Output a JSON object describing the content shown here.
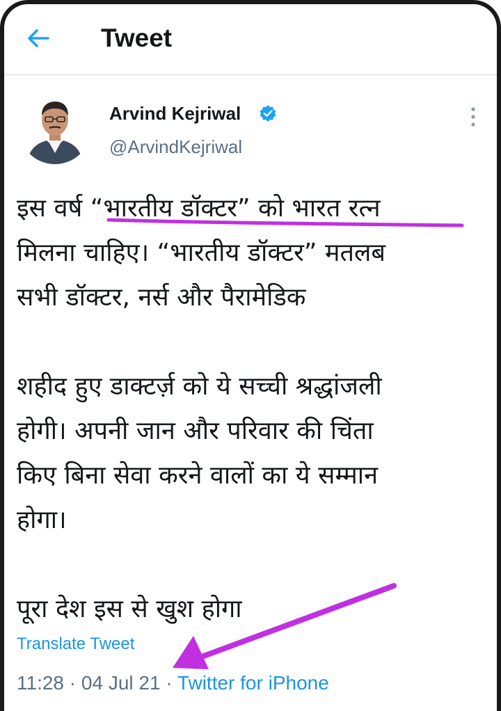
{
  "header": {
    "title": "Tweet",
    "back_icon": "arrow-left-icon"
  },
  "author": {
    "name": "Arvind Kejriwal",
    "handle": "@ArvindKejriwal",
    "verified": true
  },
  "tweet": {
    "paragraph_1": "इस वर्ष “भारतीय डॉक्टर” को भारत रत्न\nमिलना चाहिए। “भारतीय डॉक्टर” मतलब\nसभी डॉक्टर, नर्स और पैरामेडिक",
    "paragraph_2": "शहीद हुए डाक्टर्ज़ को ये सच्ची श्रद्धांजली\nहोगी। अपनी जान और परिवार की चिंता\nकिए बिना सेवा करने वालों का ये सम्मान\nहोगा।",
    "paragraph_3": "पूरा देश इस से खुश होगा",
    "translate_label": "Translate Tweet"
  },
  "meta": {
    "time": "11:28",
    "date": "04 Jul 21",
    "source": "Twitter for iPhone"
  },
  "colors": {
    "link": "#1b95e0",
    "secondary_text": "#5b7083",
    "annotation": "#c030e0"
  }
}
